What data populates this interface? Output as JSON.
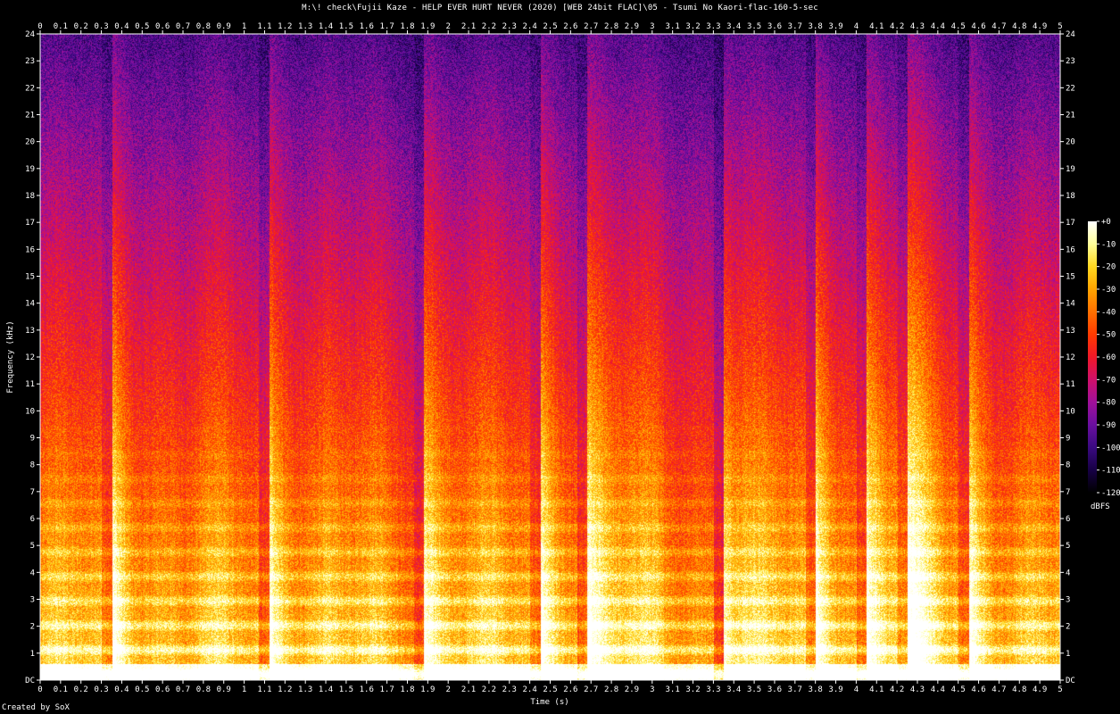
{
  "chart_data": {
    "type": "heatmap",
    "title": "M:\\! check\\Fujii Kaze - HELP EVER HURT NEVER (2020) [WEB 24bit FLAC]\\05 - Tsumi No Kaori-flac-160-5-sec",
    "xlabel": "Time (s)",
    "ylabel": "Frequency (kHz)",
    "xlim": [
      0,
      5
    ],
    "ylim": [
      0,
      24
    ],
    "x_ticks": [
      "0",
      "0.1",
      "0.2",
      "0.3",
      "0.4",
      "0.5",
      "0.6",
      "0.7",
      "0.8",
      "0.9",
      "1",
      "1.1",
      "1.2",
      "1.3",
      "1.4",
      "1.5",
      "1.6",
      "1.7",
      "1.8",
      "1.9",
      "2",
      "2.1",
      "2.2",
      "2.3",
      "2.4",
      "2.5",
      "2.6",
      "2.7",
      "2.8",
      "2.9",
      "3",
      "3.1",
      "3.2",
      "3.3",
      "3.4",
      "3.5",
      "3.6",
      "3.7",
      "3.8",
      "3.9",
      "4",
      "4.1",
      "4.2",
      "4.3",
      "4.4",
      "4.5",
      "4.6",
      "4.7",
      "4.8",
      "4.9",
      "5"
    ],
    "y_ticks": [
      "DC",
      "1",
      "2",
      "3",
      "4",
      "5",
      "6",
      "7",
      "8",
      "9",
      "10",
      "11",
      "12",
      "13",
      "14",
      "15",
      "16",
      "17",
      "18",
      "19",
      "20",
      "21",
      "22",
      "23",
      "24"
    ],
    "colorbar": {
      "label": "dBFS",
      "range": [
        -120,
        0
      ],
      "ticks": [
        "+0",
        "-10",
        "-20",
        "-30",
        "-40",
        "-50",
        "-60",
        "-70",
        "-80",
        "-90",
        "-100",
        "-110",
        "-120"
      ]
    },
    "palette": [
      "#000000",
      "#170045",
      "#3a0a80",
      "#6a0fa0",
      "#a0109a",
      "#d0106a",
      "#f01828",
      "#ff3a00",
      "#ff7000",
      "#ffa400",
      "#ffd820",
      "#ffff9a",
      "#ffffff"
    ],
    "onsets_s": [
      0.35,
      1.12,
      1.88,
      2.45,
      2.68,
      3.35,
      3.8,
      4.05,
      4.25,
      4.55
    ]
  },
  "footer": {
    "credit": "Created by SoX"
  }
}
